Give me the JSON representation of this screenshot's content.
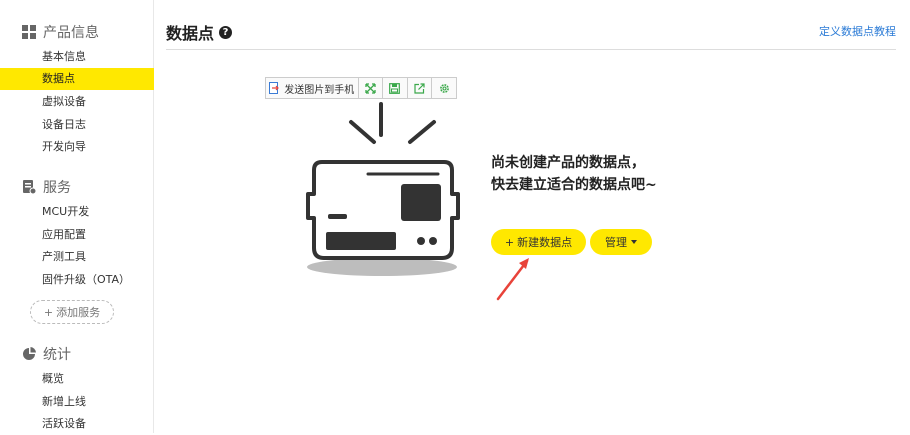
{
  "sidebar": {
    "sections": [
      {
        "title": "产品信息",
        "icon": "grid-icon",
        "items": [
          "基本信息",
          "数据点",
          "虚拟设备",
          "设备日志",
          "开发向导"
        ]
      },
      {
        "title": "服务",
        "icon": "service-icon",
        "items": [
          "MCU开发",
          "应用配置",
          "产测工具",
          "固件升级（OTA）"
        ]
      },
      {
        "title": "统计",
        "icon": "pie-chart-icon",
        "items": [
          "概览",
          "新增上线",
          "活跃设备"
        ]
      }
    ],
    "active_item": "数据点",
    "add_service": {
      "plus": "+",
      "label": "添加服务"
    }
  },
  "header": {
    "title": "数据点",
    "help": "?",
    "tutorial_link": "定义数据点教程"
  },
  "toolbar": {
    "send_label": "发送图片到手机",
    "icons": [
      "fullscreen-icon",
      "save-icon",
      "share-icon",
      "settings-icon"
    ]
  },
  "empty_state": {
    "line1": "尚未创建产品的数据点，",
    "line2": "快去建立适合的数据点吧~"
  },
  "actions": {
    "new_plus": "+",
    "new_label": "新建数据点",
    "manage_label": "管理"
  },
  "colors": {
    "accent": "#ffe800",
    "link": "#2b7bd6",
    "arrow": "#e8433a",
    "toolbar_icon": "#3aa84a"
  }
}
